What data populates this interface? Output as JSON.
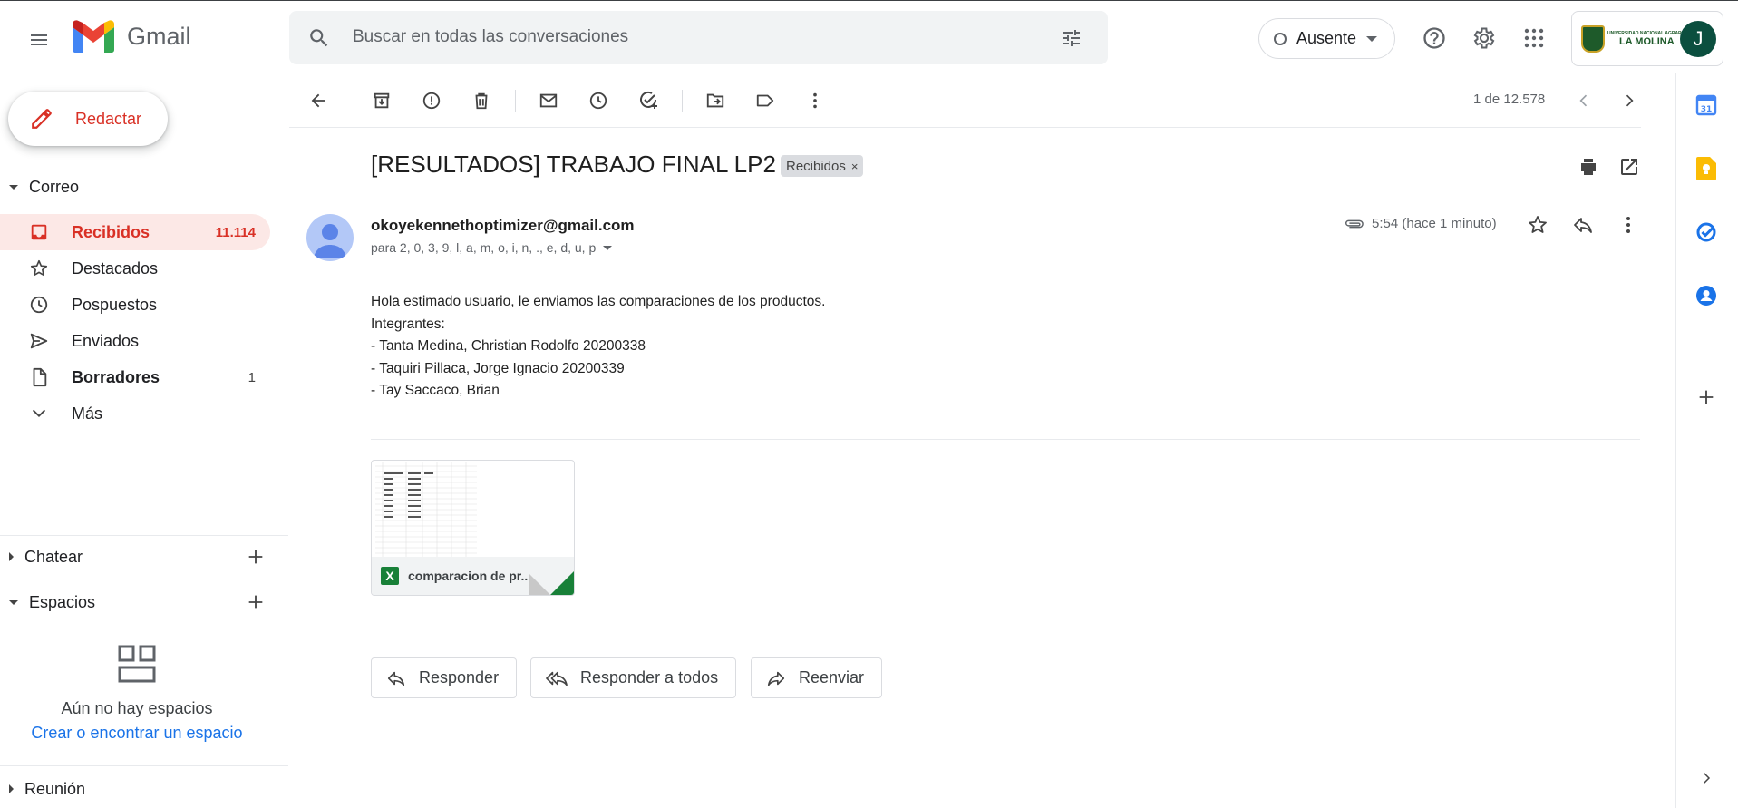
{
  "app": {
    "name": "Gmail"
  },
  "search": {
    "placeholder": "Buscar en todas las conversaciones"
  },
  "status": {
    "label": "Ausente"
  },
  "account": {
    "org_small": "UNIVERSIDAD NACIONAL AGRARIA",
    "org_big": "LA MOLINA",
    "avatar_letter": "J"
  },
  "compose": {
    "label": "Redactar"
  },
  "sidebar": {
    "mail_section": "Correo",
    "items": [
      {
        "label": "Recibidos",
        "count": "11.114",
        "icon": "inbox-icon"
      },
      {
        "label": "Destacados",
        "count": "",
        "icon": "star-icon"
      },
      {
        "label": "Pospuestos",
        "count": "",
        "icon": "clock-icon"
      },
      {
        "label": "Enviados",
        "count": "",
        "icon": "send-icon"
      },
      {
        "label": "Borradores",
        "count": "1",
        "icon": "draft-icon"
      },
      {
        "label": "Más",
        "count": "",
        "icon": "chevron-down-icon"
      }
    ],
    "chat_section": "Chatear",
    "spaces_section": "Espacios",
    "spaces_empty_text": "Aún no hay espacios",
    "spaces_link": "Crear o encontrar un espacio",
    "meet_section": "Reunión"
  },
  "toolbar": {
    "pager": "1 de 12.578"
  },
  "email": {
    "subject": "[RESULTADOS] TRABAJO FINAL LP2",
    "label": "Recibidos",
    "label_close": "×",
    "sender": "okoyekennethoptimizer@gmail.com",
    "to": "para 2, 0, 3, 9, l, a, m, o, i, n, ., e, d, u, p",
    "time": "5:54 (hace 1 minuto)",
    "body": [
      "Hola estimado usuario, le enviamos las comparaciones de los productos.",
      "Integrantes:",
      "- Tanta Medina, Christian Rodolfo 20200338",
      "- Taquiri Pillaca, Jorge Ignacio 20200339",
      "- Tay Saccaco, Brian"
    ],
    "attachment": {
      "name": "comparacion de pr...",
      "type_letter": "X"
    }
  },
  "actions": {
    "reply": "Responder",
    "reply_all": "Responder a todos",
    "forward": "Reenviar"
  },
  "colors": {
    "accent_red": "#d93025",
    "active_bg": "#fce8e6",
    "link_blue": "#1a73e8",
    "excel_green": "#188038"
  }
}
